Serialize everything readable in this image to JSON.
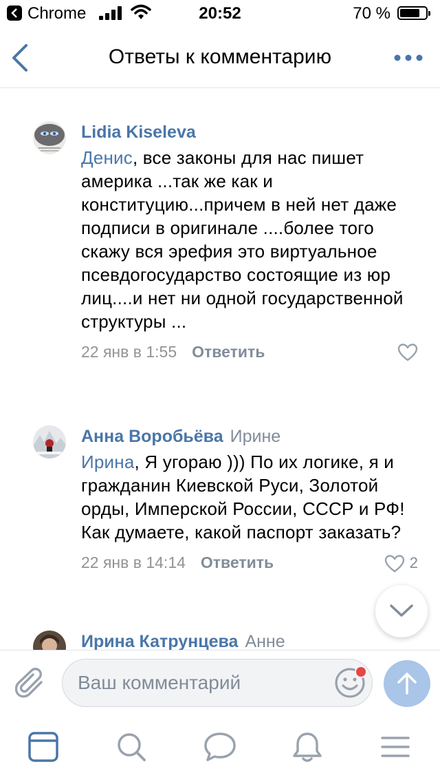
{
  "status_bar": {
    "app": "Chrome",
    "time": "20:52",
    "battery": "70 %"
  },
  "header": {
    "title": "Ответы к комментарию"
  },
  "comments": [
    {
      "author": "Lidia Kiseleva",
      "reply_to": "",
      "mention": "Денис",
      "text": ", все законы для нас пишет америка ...так же как и конституцию...причем в ней нет даже подписи в оригинале ....более того скажу вся эрефия это виртуальное псевдогосударство состоящие из юр лиц....и нет ни одной государственной структуры ...",
      "date": "22 янв в 1:55",
      "reply_label": "Ответить",
      "likes": ""
    },
    {
      "author": "Анна Воробьёва",
      "reply_to": "Ирине",
      "mention": "Ирина",
      "text": ", Я угораю ))) По их логике, я и гражданин Киевской Руси, Золотой орды, Имперской России, СССР и РФ! Как думаете, какой паспорт заказать?",
      "date": "22 янв в 14:14",
      "reply_label": "Ответить",
      "likes": "2"
    },
    {
      "author": "Ирина Катрунцева",
      "reply_to": "Анне"
    }
  ],
  "composer": {
    "placeholder": "Ваш комментарий"
  },
  "colors": {
    "link": "#4a76a8",
    "secondary": "#818c99",
    "send_button": "#a9c5e8"
  },
  "icons": {
    "back": "chevron-left-icon",
    "more": "more-dots-icon",
    "like": "heart-outline-icon",
    "attach": "paperclip-icon",
    "emoji": "smiley-icon",
    "send": "arrow-up-icon",
    "scroll": "chevron-down-icon",
    "tabs": [
      "newsfeed-icon",
      "search-icon",
      "messages-icon",
      "notifications-icon",
      "menu-icon"
    ]
  }
}
